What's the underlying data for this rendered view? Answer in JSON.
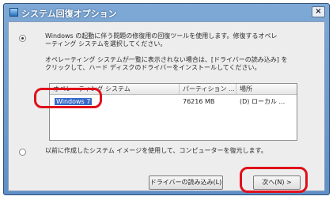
{
  "window": {
    "title": "システム回復オプション",
    "close_glyph": "×"
  },
  "option_repair": {
    "selected": true,
    "text_line1": "Windows の起動に伴う問題の修復用の回復ツールを使用します。修復するオペレ",
    "text_line2": "ーティング システムを選択してください。"
  },
  "instruction": {
    "line1": "オペレーティング システムが一覧に表示されない場合は、[ドライバーの読み込み] を",
    "line2": "クリックして、ハード ディスクのドライバーをインストールしてください。"
  },
  "os_list": {
    "columns": [
      "オペレーティング システム",
      "パーティション ...",
      "場所"
    ],
    "rows": [
      {
        "os": "Windows 7",
        "partition": "76216 MB",
        "location": "(D) ローカル ..."
      }
    ]
  },
  "option_image": {
    "selected": false,
    "text": "以前に作成したシステム イメージを使用して、コンピューターを復元します。"
  },
  "buttons": {
    "load_driver": "ドライバーの読み込み(L)",
    "next": "次へ(N) >"
  },
  "colors": {
    "highlight": "#e0101a",
    "selection": "#3769c9",
    "titlebar": "#6f9dd0"
  }
}
